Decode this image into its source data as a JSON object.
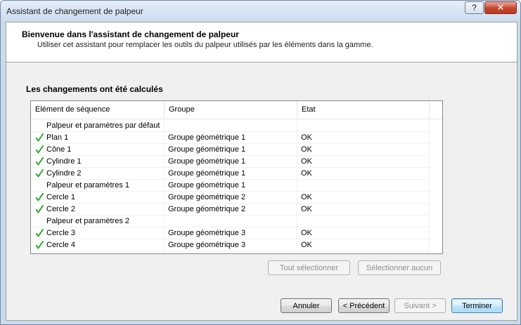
{
  "window": {
    "title": "Assistant de changement de palpeur",
    "help_label": "?",
    "close_label": "✕"
  },
  "header": {
    "title": "Bienvenue dans l'assistant de changement de palpeur",
    "subtitle": "Utiliser cet assistant pour remplacer les outils du palpeur utilisés par les éléments dans la gamme."
  },
  "section_title": "Les changements ont été calculés",
  "table": {
    "columns": [
      "Elément de séquence",
      "Groupe",
      "Etat"
    ],
    "rows": [
      {
        "element": "Palpeur et paramètres par défaut",
        "group": "",
        "state": "",
        "checked": false
      },
      {
        "element": "Plan 1",
        "group": "Groupe géométrique 1",
        "state": "OK",
        "checked": true
      },
      {
        "element": "Cône 1",
        "group": "Groupe géométrique 1",
        "state": "OK",
        "checked": true
      },
      {
        "element": "Cylindre 1",
        "group": "Groupe géométrique 1",
        "state": "OK",
        "checked": true
      },
      {
        "element": "Cylindre 2",
        "group": "Groupe géométrique 1",
        "state": "OK",
        "checked": true
      },
      {
        "element": "Palpeur et paramètres 1",
        "group": "Groupe géométrique 1",
        "state": "",
        "checked": false
      },
      {
        "element": "Cercle 1",
        "group": "Groupe géométrique 2",
        "state": "OK",
        "checked": true
      },
      {
        "element": "Cercle 2",
        "group": "Groupe géométrique 2",
        "state": "OK",
        "checked": true
      },
      {
        "element": "Palpeur et paramètres 2",
        "group": "",
        "state": "",
        "checked": false
      },
      {
        "element": "Cercle 3",
        "group": "Groupe géométrique 3",
        "state": "OK",
        "checked": true
      },
      {
        "element": "Cercle 4",
        "group": "Groupe géométrique 3",
        "state": "OK",
        "checked": true
      }
    ]
  },
  "selection_buttons": {
    "select_all": "Tout sélectionner",
    "select_none": "Sélectionner aucun"
  },
  "footer_buttons": {
    "cancel": "Annuler",
    "previous": "< Précédent",
    "next": "Suivant >",
    "finish": "Terminer"
  },
  "colors": {
    "check": "#2aa62a",
    "title_bar": "#cbdcee"
  },
  "icons": {
    "row_check": "check-icon"
  }
}
